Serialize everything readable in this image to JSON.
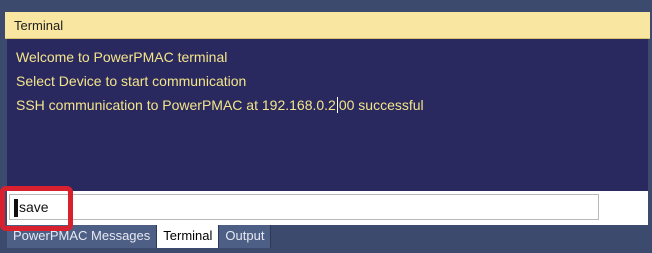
{
  "window": {
    "title": "Terminal"
  },
  "console": {
    "lines": [
      "Welcome to PowerPMAC terminal",
      "Select Device to start communication"
    ],
    "last_line_before_caret": "SSH communication to PowerPMAC at 192.168.0.2",
    "last_line_after_caret": "00 successful"
  },
  "command": {
    "value": "save"
  },
  "tabs": [
    {
      "label": "PowerPMAC Messages",
      "active": false
    },
    {
      "label": "Terminal",
      "active": true
    },
    {
      "label": "Output",
      "active": false
    }
  ],
  "colors": {
    "console_bg": "#29285f",
    "console_text": "#f4e58a",
    "titlebar_bg": "#f9e7a1",
    "highlight": "#d9202f"
  }
}
